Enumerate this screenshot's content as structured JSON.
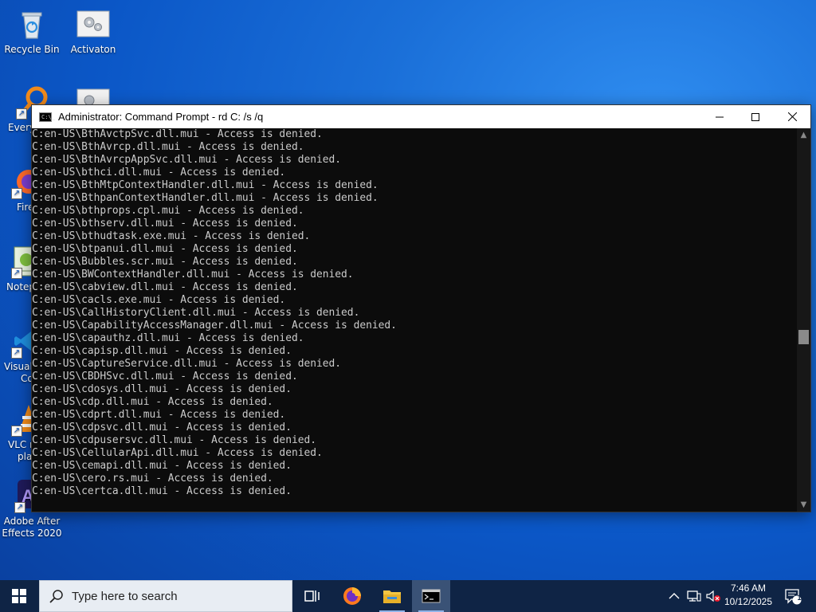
{
  "desktop": {
    "icons": [
      {
        "label": "Recycle Bin",
        "icon": "recycle-bin-icon"
      },
      {
        "label": "Activaton",
        "icon": "settings-file-icon"
      },
      {
        "label": "Every",
        "icon": "everything-search-icon"
      },
      {
        "label": "Firef",
        "icon": "firefox-icon"
      },
      {
        "label": "Notep",
        "icon": "notepad-icon"
      },
      {
        "label": "Visual",
        "label2": "Co",
        "icon": "vscode-icon"
      },
      {
        "label": "VLC m",
        "label2": "pla",
        "icon": "vlc-icon"
      },
      {
        "label": "Adobe After",
        "label2": "Effects 2020",
        "icon": "after-effects-icon"
      }
    ]
  },
  "window": {
    "title": "Administrator: Command Prompt - rd  C: /s /q",
    "console_lines": [
      "C:en-US\\BthAvctpSvc.dll.mui - Access is denied.",
      "C:en-US\\BthAvrcp.dll.mui - Access is denied.",
      "C:en-US\\BthAvrcpAppSvc.dll.mui - Access is denied.",
      "C:en-US\\bthci.dll.mui - Access is denied.",
      "C:en-US\\BthMtpContextHandler.dll.mui - Access is denied.",
      "C:en-US\\BthpanContextHandler.dll.mui - Access is denied.",
      "C:en-US\\bthprops.cpl.mui - Access is denied.",
      "C:en-US\\bthserv.dll.mui - Access is denied.",
      "C:en-US\\bthudtask.exe.mui - Access is denied.",
      "C:en-US\\btpanui.dll.mui - Access is denied.",
      "C:en-US\\Bubbles.scr.mui - Access is denied.",
      "C:en-US\\BWContextHandler.dll.mui - Access is denied.",
      "C:en-US\\cabview.dll.mui - Access is denied.",
      "C:en-US\\cacls.exe.mui - Access is denied.",
      "C:en-US\\CallHistoryClient.dll.mui - Access is denied.",
      "C:en-US\\CapabilityAccessManager.dll.mui - Access is denied.",
      "C:en-US\\capauthz.dll.mui - Access is denied.",
      "C:en-US\\capisp.dll.mui - Access is denied.",
      "C:en-US\\CaptureService.dll.mui - Access is denied.",
      "C:en-US\\CBDHSvc.dll.mui - Access is denied.",
      "C:en-US\\cdosys.dll.mui - Access is denied.",
      "C:en-US\\cdp.dll.mui - Access is denied.",
      "C:en-US\\cdprt.dll.mui - Access is denied.",
      "C:en-US\\cdpsvc.dll.mui - Access is denied.",
      "C:en-US\\cdpusersvc.dll.mui - Access is denied.",
      "C:en-US\\CellularApi.dll.mui - Access is denied.",
      "C:en-US\\cemapi.dll.mui - Access is denied.",
      "C:en-US\\cero.rs.mui - Access is denied.",
      "C:en-US\\certca.dll.mui - Access is denied."
    ],
    "scroll_position_fraction": 0.55
  },
  "taskbar": {
    "search_placeholder": "Type here to search",
    "pinned": [
      "task-view-icon",
      "firefox-icon",
      "file-explorer-icon",
      "command-prompt-icon"
    ],
    "clock_time": "7:46 AM",
    "clock_date": "10/12/2025",
    "notification_count": "1"
  },
  "colors": {
    "desktop_blue": "#0b57c7",
    "console_bg": "#0c0c0c",
    "console_text": "#cccccc",
    "taskbar_bg": "#0f2445"
  }
}
